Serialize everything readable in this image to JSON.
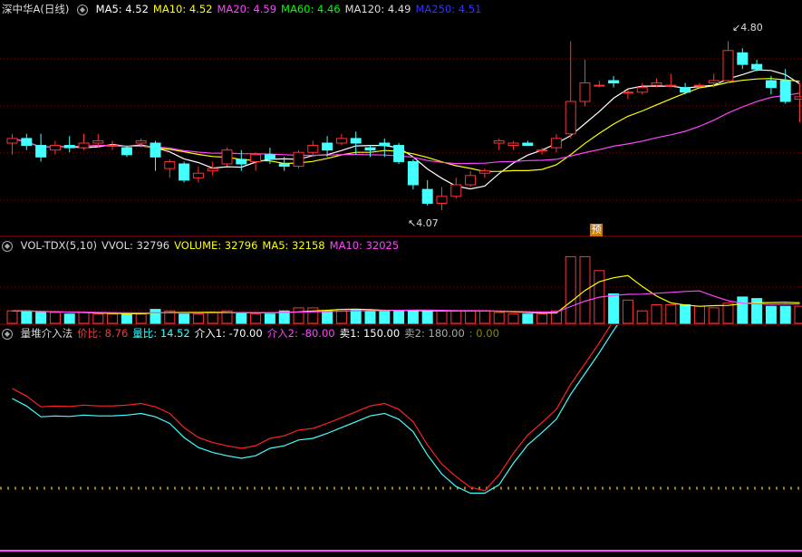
{
  "main": {
    "title": "深中华A(日线)",
    "indicators": [
      {
        "label": "MA5: 4.52",
        "color": "#ffffff"
      },
      {
        "label": "MA10: 4.52",
        "color": "#ffff00"
      },
      {
        "label": "MA20: 4.59",
        "color": "#ff44ff"
      },
      {
        "label": "MA60: 4.46",
        "color": "#00ff00"
      },
      {
        "label": "MA120: 4.49",
        "color": "#dddddd"
      },
      {
        "label": "MA250: 4.51",
        "color": "#3333ff"
      }
    ],
    "high_label": "4.80",
    "low_label": "4.07",
    "predict_marker": "预"
  },
  "volume": {
    "indicators": [
      {
        "label": "VOL-TDX(5,10)",
        "color": "#dddddd"
      },
      {
        "label": "VVOL: 32796",
        "color": "#dddddd"
      },
      {
        "label": "VOLUME: 32796",
        "color": "#ffff00"
      },
      {
        "label": "MA5: 32158",
        "color": "#ffff00"
      },
      {
        "label": "MA10: 32025",
        "color": "#ff44ff"
      }
    ]
  },
  "indicator": {
    "indicators": [
      {
        "label": "量堆介入法",
        "color": "#dddddd"
      },
      {
        "label": "价比: 8.76",
        "color": "#ff3333"
      },
      {
        "label": "量比: 14.52",
        "color": "#44ffff"
      },
      {
        "label": "介入1: -70.00",
        "color": "#ffffff"
      },
      {
        "label": "介入2: -80.00",
        "color": "#ff44ff"
      },
      {
        "label": "卖1: 150.00",
        "color": "#ffffff"
      },
      {
        "label": "卖2: 180.00",
        "color": "#aaaaaa"
      },
      {
        "label": ": 0.00",
        "color": "#888800"
      }
    ]
  },
  "colors": {
    "up": "#ff3333",
    "down": "#44ffff",
    "grid": "#8b0000"
  },
  "chart_data": {
    "type": "candlestick",
    "price_range": [
      4.0,
      4.9
    ],
    "candles": [
      [
        4.36,
        4.38,
        4.31,
        4.4
      ],
      [
        4.38,
        4.35,
        4.33,
        4.4
      ],
      [
        4.35,
        4.3,
        4.28,
        4.4
      ],
      [
        4.33,
        4.35,
        4.31,
        4.37
      ],
      [
        4.35,
        4.34,
        4.32,
        4.39
      ],
      [
        4.34,
        4.36,
        4.33,
        4.4
      ],
      [
        4.36,
        4.37,
        4.34,
        4.4
      ],
      [
        4.35,
        4.35,
        4.33,
        4.37
      ],
      [
        4.34,
        4.31,
        4.3,
        4.35
      ],
      [
        4.36,
        4.37,
        4.34,
        4.38
      ],
      [
        4.36,
        4.3,
        4.24,
        4.37
      ],
      [
        4.25,
        4.28,
        4.21,
        4.29
      ],
      [
        4.27,
        4.2,
        4.19,
        4.28
      ],
      [
        4.21,
        4.23,
        4.19,
        4.26
      ],
      [
        4.24,
        4.25,
        4.22,
        4.28
      ],
      [
        4.27,
        4.33,
        4.26,
        4.34
      ],
      [
        4.29,
        4.27,
        4.24,
        4.33
      ],
      [
        4.28,
        4.31,
        4.24,
        4.32
      ],
      [
        4.31,
        4.29,
        4.27,
        4.34
      ],
      [
        4.27,
        4.26,
        4.24,
        4.3
      ],
      [
        4.26,
        4.32,
        4.25,
        4.33
      ],
      [
        4.32,
        4.35,
        4.3,
        4.37
      ],
      [
        4.36,
        4.33,
        4.3,
        4.39
      ],
      [
        4.36,
        4.38,
        4.35,
        4.4
      ],
      [
        4.38,
        4.36,
        4.31,
        4.41
      ],
      [
        4.34,
        4.33,
        4.3,
        4.35
      ],
      [
        4.36,
        4.35,
        4.3,
        4.38
      ],
      [
        4.35,
        4.28,
        4.27,
        4.36
      ],
      [
        4.28,
        4.18,
        4.16,
        4.29
      ],
      [
        4.16,
        4.1,
        4.09,
        4.2
      ],
      [
        4.1,
        4.13,
        4.07,
        4.17
      ],
      [
        4.13,
        4.18,
        4.12,
        4.21
      ],
      [
        4.18,
        4.22,
        4.17,
        4.24
      ],
      [
        4.23,
        4.24,
        4.21,
        4.25
      ],
      [
        4.36,
        4.37,
        4.33,
        4.38
      ],
      [
        4.35,
        4.36,
        4.33,
        4.37
      ],
      [
        4.36,
        4.35,
        4.35,
        4.37
      ],
      [
        4.33,
        4.33,
        4.31,
        4.34
      ],
      [
        4.34,
        4.38,
        4.32,
        4.4
      ],
      [
        4.4,
        4.54,
        4.38,
        4.8
      ],
      [
        4.54,
        4.62,
        4.52,
        4.72
      ],
      [
        4.61,
        4.61,
        4.6,
        4.63
      ],
      [
        4.63,
        4.62,
        4.6,
        4.65
      ],
      [
        4.58,
        4.58,
        4.55,
        4.59
      ],
      [
        4.58,
        4.6,
        4.57,
        4.62
      ],
      [
        4.61,
        4.62,
        4.6,
        4.64
      ],
      [
        4.61,
        4.61,
        4.6,
        4.66
      ],
      [
        4.6,
        4.58,
        4.57,
        4.62
      ],
      [
        4.61,
        4.61,
        4.6,
        4.62
      ],
      [
        4.62,
        4.63,
        4.6,
        4.66
      ],
      [
        4.63,
        4.76,
        4.62,
        4.8
      ],
      [
        4.75,
        4.7,
        4.68,
        4.77
      ],
      [
        4.7,
        4.68,
        4.67,
        4.72
      ],
      [
        4.63,
        4.6,
        4.57,
        4.65
      ],
      [
        4.63,
        4.54,
        4.53,
        4.68
      ],
      [
        4.55,
        4.56,
        4.45,
        4.62
      ]
    ],
    "volumes": [
      8,
      8,
      7,
      7,
      6,
      7,
      6,
      6,
      6,
      6,
      9,
      8,
      6,
      6,
      7,
      8,
      7,
      6,
      6,
      8,
      10,
      10,
      8,
      9,
      9,
      8,
      8,
      8,
      8,
      8,
      8,
      8,
      8,
      8,
      7,
      6,
      6,
      6,
      8,
      43,
      43,
      34,
      19,
      15,
      8,
      12,
      12,
      12,
      11,
      10,
      13,
      17,
      16,
      11,
      11,
      11
    ],
    "y_levels": [
      150,
      180
    ]
  }
}
